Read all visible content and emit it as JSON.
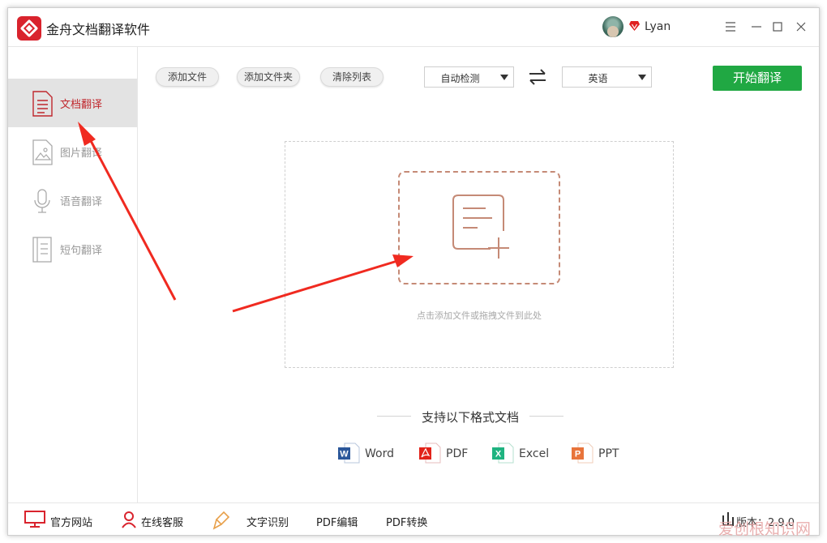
{
  "app": {
    "title": "金舟文档翻译软件",
    "user_name": "Lyan"
  },
  "sidebar": {
    "items": [
      {
        "label": "文档翻译",
        "icon": "document-icon",
        "active": true
      },
      {
        "label": "图片翻译",
        "icon": "image-icon",
        "active": false
      },
      {
        "label": "语音翻译",
        "icon": "microphone-icon",
        "active": false
      },
      {
        "label": "短句翻译",
        "icon": "sentence-icon",
        "active": false
      }
    ]
  },
  "toolbar": {
    "add_file": "添加文件",
    "add_folder": "添加文件夹",
    "clear_list": "清除列表",
    "source_lang": "自动检测",
    "target_lang": "英语",
    "start": "开始翻译"
  },
  "drop_zone": {
    "hint": "点击添加文件或拖拽文件到此处"
  },
  "formats": {
    "title": "支持以下格式文档",
    "items": [
      {
        "label": "Word",
        "icon": "word-icon",
        "color": "#2b579a"
      },
      {
        "label": "PDF",
        "icon": "pdf-icon",
        "color": "#e2231a"
      },
      {
        "label": "Excel",
        "icon": "excel-icon",
        "color": "#1fb380"
      },
      {
        "label": "PPT",
        "icon": "ppt-icon",
        "color": "#e8743b"
      }
    ]
  },
  "footer": {
    "website": "官方网站",
    "service": "在线客服",
    "ocr": "文字识别",
    "pdf_edit": "PDF编辑",
    "pdf_convert": "PDF转换",
    "version": "版本：2.9.0"
  },
  "watermark": "爱创根知识网",
  "colors": {
    "accent_red": "#c0272d",
    "start_green": "#20a843",
    "annotation_arrow": "#f02a20"
  }
}
